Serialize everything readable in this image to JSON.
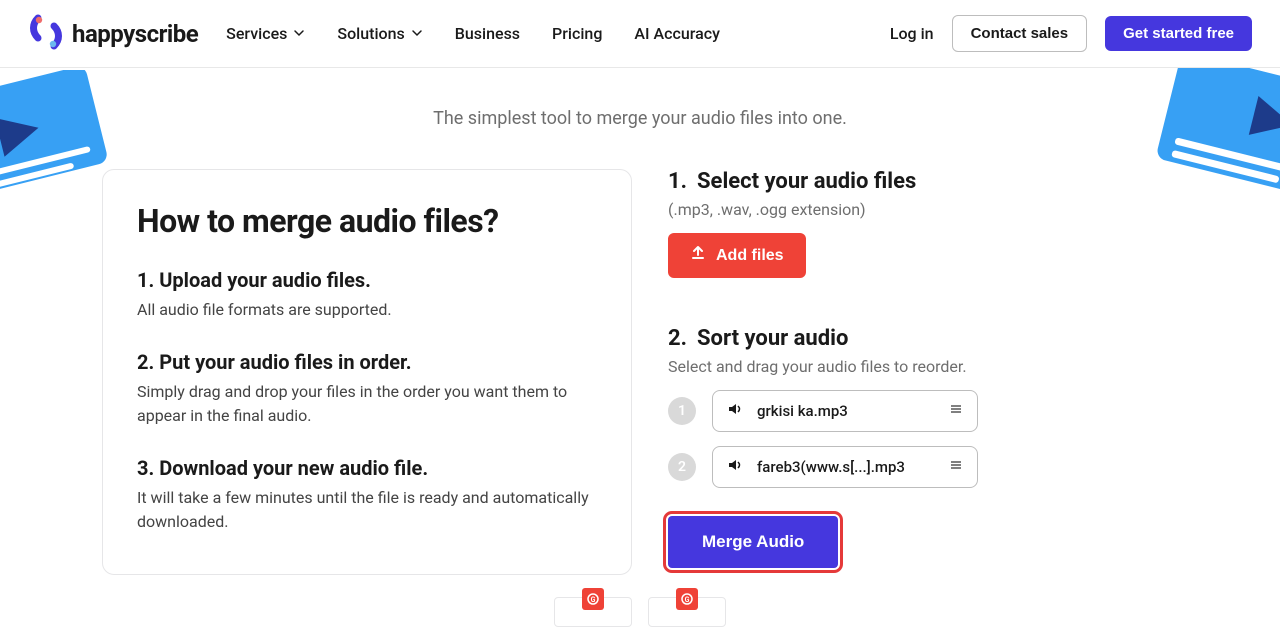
{
  "brand": "happyscribe",
  "nav": {
    "services": "Services",
    "solutions": "Solutions",
    "business": "Business",
    "pricing": "Pricing",
    "accuracy": "AI Accuracy",
    "login": "Log in",
    "contact": "Contact sales",
    "cta": "Get started free"
  },
  "hero": {
    "subtitle": "The simplest tool to merge your audio files into one."
  },
  "howto": {
    "heading": "How to merge audio files?",
    "s1h": "1. Upload your audio files.",
    "s1p": "All audio file formats are supported.",
    "s2h": "2. Put your audio files in order.",
    "s2p": "Simply drag and drop your files in the order you want them to appear in the final audio.",
    "s3h": "3. Download your new audio file.",
    "s3p": "It will take a few minutes until the file is ready and automatically downloaded."
  },
  "right": {
    "step1_num": "1.",
    "step1_title": "Select your audio files",
    "step1_desc": "(.mp3, .wav, .ogg extension)",
    "add_files": "Add files",
    "step2_num": "2.",
    "step2_title": "Sort your audio",
    "step2_desc": "Select and drag your audio files to reorder.",
    "file1_idx": "1",
    "file1_name": "grkisi ka.mp3",
    "file2_idx": "2",
    "file2_name": "fareb3(www.s[...].mp3",
    "merge": "Merge Audio"
  },
  "colors": {
    "primary": "#4537de",
    "red": "#ef4237",
    "gray": "#6e6e6e"
  }
}
